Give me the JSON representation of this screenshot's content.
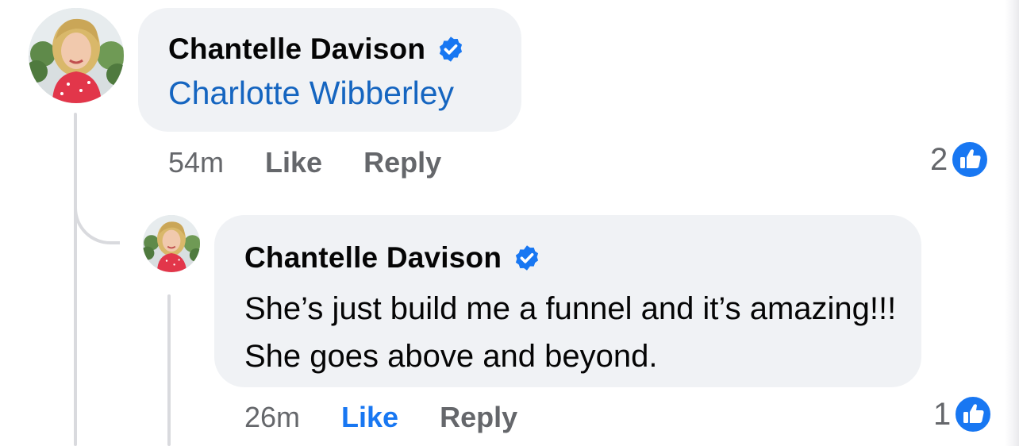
{
  "colors": {
    "bubble_background": "#f0f2f5",
    "mention_link": "#1565c0",
    "liked_accent": "#1877f2",
    "meta_text": "#65676b",
    "thread_line": "#d9dade"
  },
  "comment": {
    "author": "Chantelle Davison",
    "author_icon": "verified-badge-icon",
    "mention": "Charlotte Wibberley",
    "timestamp": "54m",
    "like_label": "Like",
    "liked": false,
    "reply_label": "Reply",
    "reaction_count": "2",
    "reaction_icon": "thumbs-up-icon"
  },
  "reply": {
    "author": "Chantelle Davison",
    "author_icon": "verified-badge-icon",
    "text": "She’s just build me a funnel and it’s amazing!!! She goes above and beyond.",
    "timestamp": "26m",
    "like_label": "Like",
    "liked": true,
    "reply_label": "Reply",
    "reaction_count": "1",
    "reaction_icon": "thumbs-up-icon"
  }
}
